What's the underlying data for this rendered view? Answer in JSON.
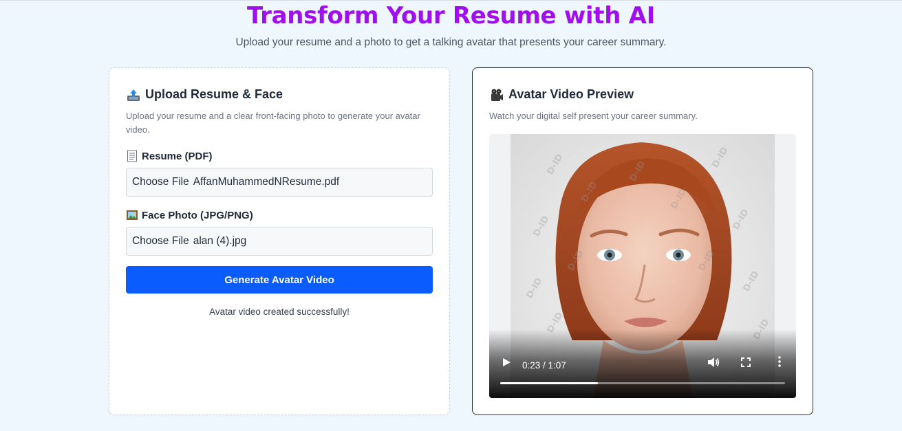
{
  "hero": {
    "title": "Transform Your Resume with AI",
    "subtitle": "Upload your resume and a photo to get a talking avatar that presents your career summary."
  },
  "upload_card": {
    "icon": "outbox-tray-icon",
    "title": "Upload Resume & Face",
    "description": "Upload your resume and a clear front-facing photo to generate your avatar video.",
    "resume_field": {
      "icon": "page-icon",
      "label": "Resume (PDF)",
      "button_label": "Choose File",
      "file_name": "AffanMuhammedNResume.pdf"
    },
    "photo_field": {
      "icon": "framed-picture-icon",
      "label": "Face Photo (JPG/PNG)",
      "button_label": "Choose File",
      "file_name": "alan (4).jpg"
    },
    "generate_label": "Generate Avatar Video",
    "status_message": "Avatar video created successfully!"
  },
  "preview_card": {
    "icon": "video-camera-icon",
    "title": "Avatar Video Preview",
    "description": "Watch your digital self present your career summary.",
    "video": {
      "current_time": "0:23",
      "duration": "1:07",
      "time_display": "0:23 / 1:07",
      "progress": 0.343,
      "watermark_text": "D-ID"
    }
  },
  "colors": {
    "title_purple": "#a10ff0",
    "primary_blue": "#0b5cff",
    "background": "#eef7fd"
  }
}
